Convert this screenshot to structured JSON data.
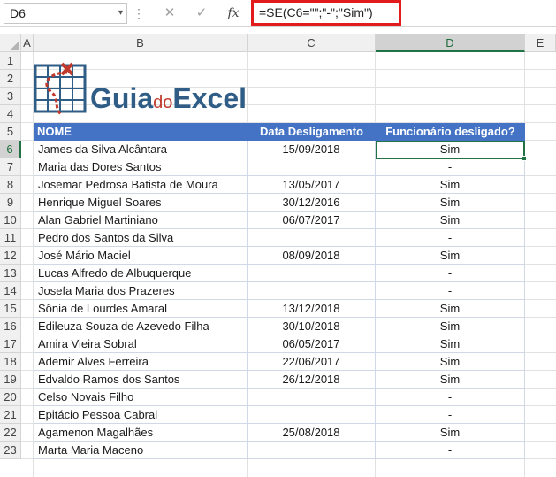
{
  "name_box": "D6",
  "formula": "=SE(C6=\"\";\"-\";\"Sim\")",
  "icons": {
    "cancel": "✕",
    "enter": "✓",
    "fx": "fx",
    "dots": "⋮",
    "dropdown": "▾"
  },
  "columns": [
    "A",
    "B",
    "C",
    "D",
    "E"
  ],
  "rows": [
    "1",
    "2",
    "3",
    "4",
    "5",
    "6",
    "7",
    "8",
    "9",
    "10",
    "11",
    "12",
    "13",
    "14",
    "15",
    "16",
    "17",
    "18",
    "19",
    "20",
    "21",
    "22",
    "23"
  ],
  "logo": {
    "part1": "Guia",
    "part2": "do",
    "part3": "Excel"
  },
  "table": {
    "headers": [
      "NOME",
      "Data Desligamento",
      "Funcionário desligado?"
    ],
    "rows": [
      {
        "name": "James da Silva Alcântara",
        "date": "15/09/2018",
        "status": "Sim"
      },
      {
        "name": "Maria das Dores Santos",
        "date": "",
        "status": "-"
      },
      {
        "name": "Josemar Pedrosa Batista de Moura",
        "date": "13/05/2017",
        "status": "Sim"
      },
      {
        "name": "Henrique Miguel Soares",
        "date": "30/12/2016",
        "status": "Sim"
      },
      {
        "name": "Alan Gabriel Martiniano",
        "date": "06/07/2017",
        "status": "Sim"
      },
      {
        "name": "Pedro dos Santos da Silva",
        "date": "",
        "status": "-"
      },
      {
        "name": "José Mário Maciel",
        "date": "08/09/2018",
        "status": "Sim"
      },
      {
        "name": "Lucas Alfredo de Albuquerque",
        "date": "",
        "status": "-"
      },
      {
        "name": "Josefa Maria dos Prazeres",
        "date": "",
        "status": "-"
      },
      {
        "name": "Sônia de Lourdes Amaral",
        "date": "13/12/2018",
        "status": "Sim"
      },
      {
        "name": "Edileuza Souza de Azevedo Filha",
        "date": "30/10/2018",
        "status": "Sim"
      },
      {
        "name": "Amira Vieira Sobral",
        "date": "06/05/2017",
        "status": "Sim"
      },
      {
        "name": "Ademir Alves Ferreira",
        "date": "22/06/2017",
        "status": "Sim"
      },
      {
        "name": "Edvaldo Ramos dos Santos",
        "date": "26/12/2018",
        "status": "Sim"
      },
      {
        "name": "Celso Novais Filho",
        "date": "",
        "status": "-"
      },
      {
        "name": "Epitácio Pessoa Cabral",
        "date": "",
        "status": "-"
      },
      {
        "name": "Agamenon Magalhães",
        "date": "25/08/2018",
        "status": "Sim"
      },
      {
        "name": "Marta Maria Maceno",
        "date": "",
        "status": "-"
      }
    ]
  },
  "colors": {
    "header_blue": "#4472c4",
    "excel_green": "#217346",
    "highlight_red": "#e21c1c",
    "logo_blue": "#2f5d86"
  }
}
